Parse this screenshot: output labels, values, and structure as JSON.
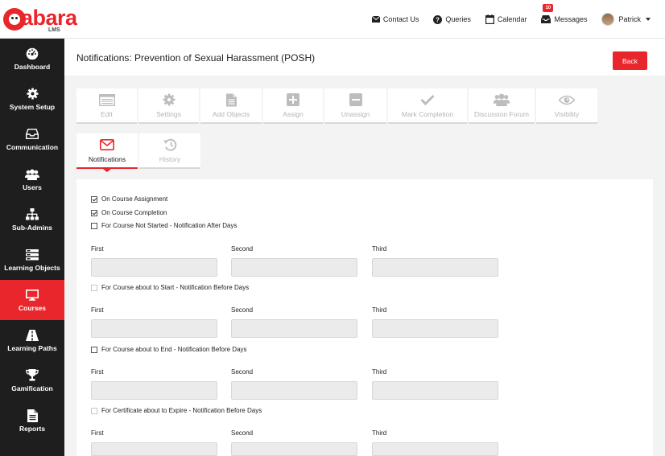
{
  "logo": {
    "text": "abara",
    "sub": "LMS"
  },
  "topnav": {
    "contact": "Contact Us",
    "queries": "Queries",
    "calendar": "Calendar",
    "messages": "Messages",
    "messages_count": "10",
    "user": "Patrick"
  },
  "sidebar": {
    "items": [
      {
        "label": "Dashboard",
        "icon": "dashboard-icon"
      },
      {
        "label": "System Setup",
        "icon": "gear-icon"
      },
      {
        "label": "Communication",
        "icon": "inbox-icon"
      },
      {
        "label": "Users",
        "icon": "users-icon"
      },
      {
        "label": "Sub-Admins",
        "icon": "sitemap-icon"
      },
      {
        "label": "Learning Objects",
        "icon": "layers-icon"
      },
      {
        "label": "Courses",
        "icon": "monitor-icon"
      },
      {
        "label": "Learning Paths",
        "icon": "road-icon"
      },
      {
        "label": "Gamification",
        "icon": "trophy-icon"
      },
      {
        "label": "Reports",
        "icon": "file-icon"
      }
    ]
  },
  "header": {
    "title": "Notifications: Prevention of Sexual Harassment (POSH)",
    "back": "Back"
  },
  "toolbar": {
    "items": [
      "Edit",
      "Settings",
      "Add Objects",
      "Assign",
      "Unassign",
      "Mark Completion",
      "Discussion Forum",
      "Visibility"
    ]
  },
  "tabs": {
    "notifications": "Notifications",
    "history": "History"
  },
  "form": {
    "assignment": "On Course Assignment",
    "completion": "On Course Completion",
    "not_started": "For Course Not Started - Notification After Days",
    "about_start": "For Course about to Start - Notification Before Days",
    "about_end": "For Course about to End - Notification Before Days",
    "cert_expire": "For Certificate about to Expire - Notification Before Days",
    "first": "First",
    "second": "Second",
    "third": "Third"
  },
  "colors": {
    "accent": "#e8262c",
    "sidebar": "#1e1e1e"
  }
}
